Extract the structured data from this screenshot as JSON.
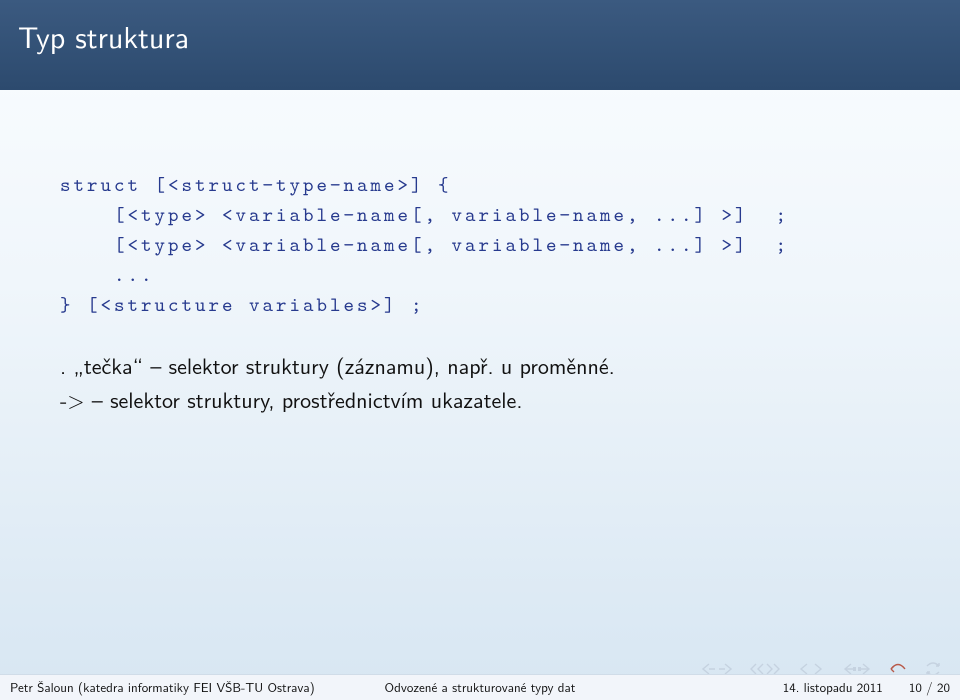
{
  "title": "Typ struktura",
  "code": {
    "l1": "struct [<struct−type−name>] {",
    "l2": "    [<type> <variable−name[, variable−name, ...] >]  ;",
    "l3": "    [<type> <variable−name[, variable−name, ...] >]  ;",
    "l4": "    ...",
    "l5": "} [<structure variables>] ;"
  },
  "body": {
    "line1": ". „tečka“ – selektor struktury (záznamu), např. u proměnné.",
    "line2": "-> – selektor struktury, prostřednictvím ukazatele."
  },
  "footer": {
    "author": "Petr Šaloun (katedra informatiky FEI VŠB-TU Ostrava)",
    "center": "Odvozené a strukturované typy dat",
    "date": "14. listopadu 2011",
    "page": "10 / 20"
  },
  "icons": {
    "prev_section": "prev-section-icon",
    "next_section": "next-section-icon",
    "prev_slide": "prev-slide-icon",
    "next_slide": "next-slide-icon",
    "back": "back-icon",
    "forward": "forward-icon",
    "home": "home-icon",
    "refresh": "refresh-icon"
  },
  "colors": {
    "title_bg_top": "#3b5a80",
    "title_bg_bottom": "#2c4a6e",
    "code_color": "#273a8e",
    "nav_icon": "#c5d2e0",
    "nav_icon_accent": "#b85a4a"
  }
}
